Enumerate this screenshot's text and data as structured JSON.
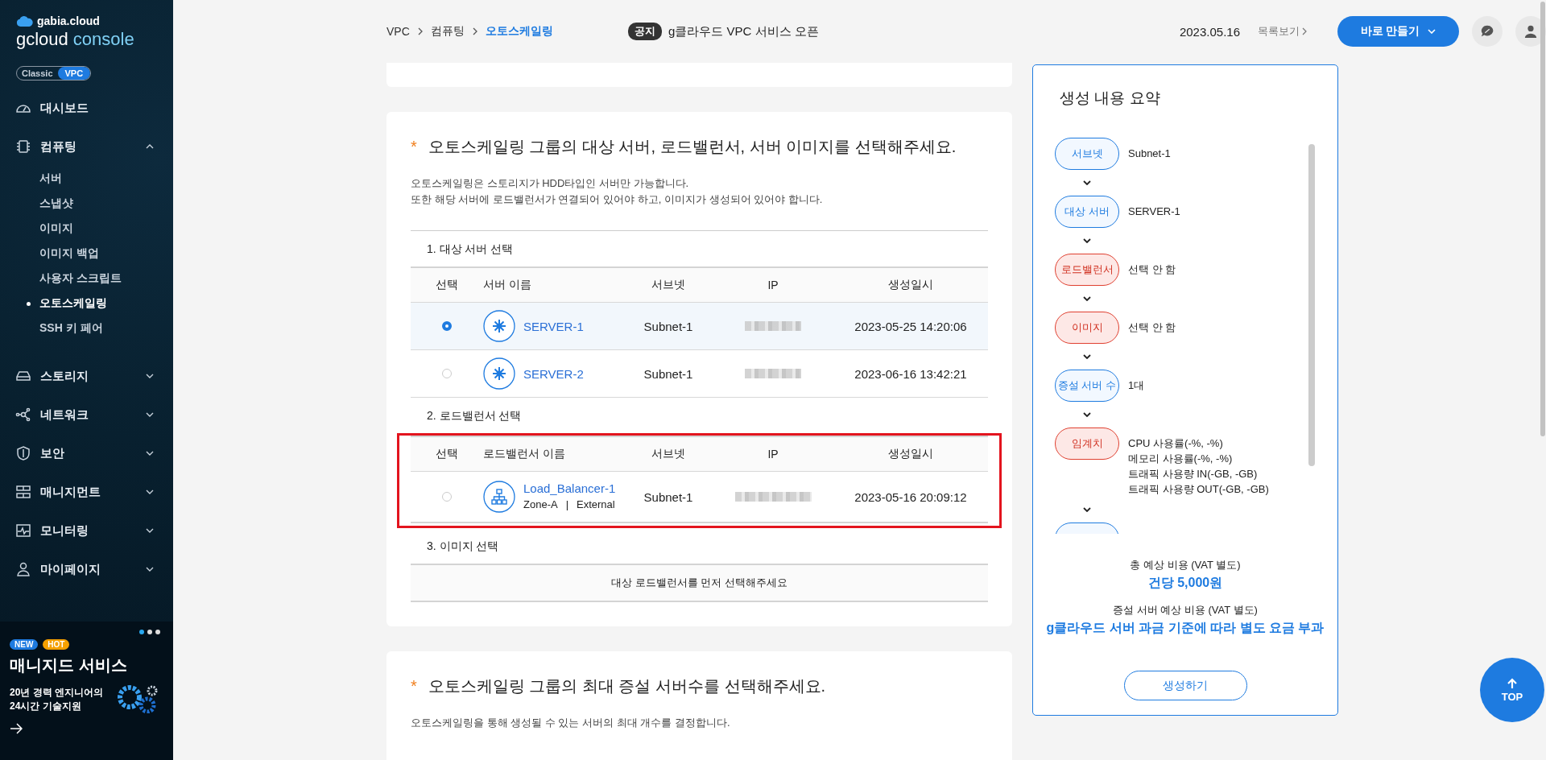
{
  "sidebar": {
    "brand": "gabia.cloud",
    "product_name": "gcloud",
    "product_suffix": "console",
    "mode_toggle": [
      {
        "label": "Classic",
        "selected": false
      },
      {
        "label": "VPC",
        "selected": true
      }
    ],
    "menu": [
      {
        "label": "대시보드",
        "kind": "dashboard"
      },
      {
        "label": "컴퓨팅",
        "kind": "chip",
        "expanded": true,
        "children": [
          {
            "label": "서버",
            "selected": false
          },
          {
            "label": "스냅샷",
            "selected": false
          },
          {
            "label": "이미지",
            "selected": false
          },
          {
            "label": "이미지 백업",
            "selected": false
          },
          {
            "label": "사용자 스크립트",
            "selected": false
          },
          {
            "label": "오토스케일링",
            "selected": true
          },
          {
            "label": "SSH 키 페어",
            "selected": false
          }
        ]
      },
      {
        "label": "스토리지",
        "kind": "storage",
        "expanded": false
      },
      {
        "label": "네트워크",
        "kind": "network",
        "expanded": false
      },
      {
        "label": "보안",
        "kind": "shield",
        "expanded": false
      },
      {
        "label": "매니지먼트",
        "kind": "management",
        "expanded": false
      },
      {
        "label": "모니터링",
        "kind": "monitor",
        "expanded": false
      },
      {
        "label": "마이페이지",
        "kind": "user",
        "expanded": false
      }
    ],
    "promo": {
      "pages": [
        {
          "selected": true
        },
        {
          "selected": false
        },
        {
          "selected": false
        }
      ],
      "badges": [
        {
          "label": "NEW",
          "color": "#1e7be0"
        },
        {
          "label": "HOT",
          "color": "#f5a000"
        }
      ],
      "title": "매니지드 서비스",
      "lines": [
        "20년 경력 엔지니어의",
        "24시간 기술지원"
      ]
    }
  },
  "header": {
    "breadcrumb": [
      {
        "label": "VPC",
        "selected": false
      },
      {
        "label": "컴퓨팅",
        "selected": false
      },
      {
        "label": "오토스케일링",
        "selected": true
      }
    ],
    "notice": {
      "badge": "공지",
      "text": "g클라우드 VPC 서비스 오픈",
      "date": "2023.05.16",
      "more": "목록보기"
    },
    "create_button": "바로 만들기"
  },
  "section_1": {
    "required_mark": "*",
    "title": "오토스케일링 그룹의 대상 서버, 로드밸런서, 서버 이미지를 선택해주세요.",
    "description": [
      "오토스케일링은 스토리지가 HDD타입인 서버만 가능합니다.",
      "또한 해당 서버에 로드밸런서가 연결되어 있어야 하고, 이미지가 생성되어 있어야 합니다."
    ],
    "server_step": {
      "title": "1. 대상 서버 선택",
      "columns": [
        "선택",
        "서버 이름",
        "서브넷",
        "IP",
        "생성일시"
      ],
      "rows": [
        {
          "selected": true,
          "name": "SERVER-1",
          "subnet": "Subnet-1",
          "created": "2023-05-25 14:20:06"
        },
        {
          "selected": false,
          "name": "SERVER-2",
          "subnet": "Subnet-1",
          "created": "2023-06-16 13:42:21"
        }
      ]
    },
    "lb_step": {
      "title": "2. 로드밸런서 선택",
      "columns": [
        "선택",
        "로드밸런서 이름",
        "서브넷",
        "IP",
        "생성일시"
      ],
      "rows": [
        {
          "selected": false,
          "name": "Load_Balancer-1",
          "zone": "Zone-A",
          "separator": "|",
          "type": "External",
          "subnet": "Subnet-1",
          "created": "2023-05-16 20:09:12"
        }
      ]
    },
    "image_step": {
      "title": "3. 이미지 선택",
      "empty_message": "대상 로드밸런서를 먼저 선택해주세요"
    }
  },
  "section_2": {
    "required_mark": "*",
    "title": "오토스케일링 그룹의 최대 증설 서버수를 선택해주세요.",
    "description": "오토스케일링을 통해 생성될 수 있는 서버의 최대 개수를 결정합니다."
  },
  "summary": {
    "title": "생성 내용 요약",
    "items": [
      {
        "label": "서브넷",
        "complete": true,
        "values": [
          "Subnet-1"
        ]
      },
      {
        "label": "대상 서버",
        "complete": true,
        "values": [
          "SERVER-1"
        ]
      },
      {
        "label": "로드밸런서",
        "complete": false,
        "values": [
          "선택 안 함"
        ]
      },
      {
        "label": "이미지",
        "complete": false,
        "values": [
          "선택 안 함"
        ]
      },
      {
        "label": "증설 서버 수",
        "complete": true,
        "values": [
          "1대"
        ]
      },
      {
        "label": "임계치",
        "complete": false,
        "values": [
          "CPU 사용률(-%, -%)",
          "메모리 사용률(-%, -%)",
          "트래픽 사용량 IN(-GB, -GB)",
          "트래픽 사용량 OUT(-GB, -GB)"
        ]
      },
      {
        "complete": true
      }
    ],
    "cost_label": "총 예상 비용 (VAT 별도)",
    "cost_value": "건당 5,000원",
    "extra_label": "증설 서버 예상 비용 (VAT 별도)",
    "extra_value": "g클라우드 서버 과금 기준에 따라 별도 요금 부과",
    "submit": "생성하기"
  },
  "top_button": "TOP"
}
